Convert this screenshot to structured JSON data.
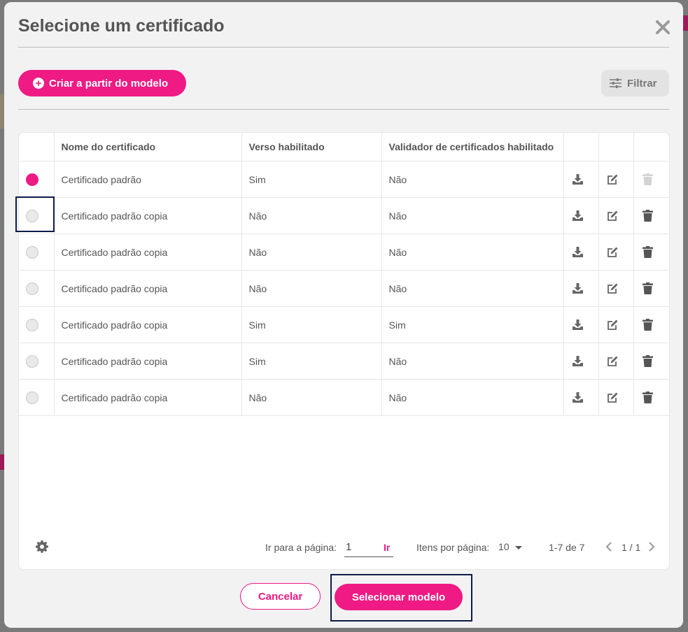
{
  "modal": {
    "title": "Selecione um certificado",
    "close_icon": "close-icon"
  },
  "toolbar": {
    "create_label": "Criar a partir do modelo",
    "create_icon": "plus-circle-icon",
    "filter_label": "Filtrar",
    "filter_icon": "sliders-icon"
  },
  "table": {
    "columns": [
      "Nome do certificado",
      "Verso habilitado",
      "Validador de certificados habilitado"
    ],
    "action_icons": [
      "download-icon",
      "edit-icon",
      "trash-icon"
    ],
    "rows": [
      {
        "name": "Certificado padrão",
        "verso": "Sim",
        "validador": "Não",
        "selected": true,
        "delete_enabled": false
      },
      {
        "name": "Certificado padrão copia",
        "verso": "Não",
        "validador": "Não",
        "selected": false,
        "delete_enabled": true
      },
      {
        "name": "Certificado padrão copia",
        "verso": "Não",
        "validador": "Não",
        "selected": false,
        "delete_enabled": true
      },
      {
        "name": "Certificado padrão copia",
        "verso": "Não",
        "validador": "Não",
        "selected": false,
        "delete_enabled": true
      },
      {
        "name": "Certificado padrão copia",
        "verso": "Sim",
        "validador": "Sim",
        "selected": false,
        "delete_enabled": true
      },
      {
        "name": "Certificado padrão copia",
        "verso": "Sim",
        "validador": "Não",
        "selected": false,
        "delete_enabled": true
      },
      {
        "name": "Certificado padrão copia",
        "verso": "Não",
        "validador": "Não",
        "selected": false,
        "delete_enabled": true
      }
    ]
  },
  "pagination": {
    "settings_icon": "gear-icon",
    "goto_label": "Ir para a página:",
    "goto_value": "1",
    "go_label": "Ir",
    "per_page_label": "Itens por página:",
    "per_page_value": "10",
    "range": "1-7 de 7",
    "page_of": "1 / 1"
  },
  "footer": {
    "cancel_label": "Cancelar",
    "select_label": "Selecionar modelo"
  },
  "colors": {
    "accent": "#ef1a83",
    "focus_outline": "#0d1b4a"
  }
}
